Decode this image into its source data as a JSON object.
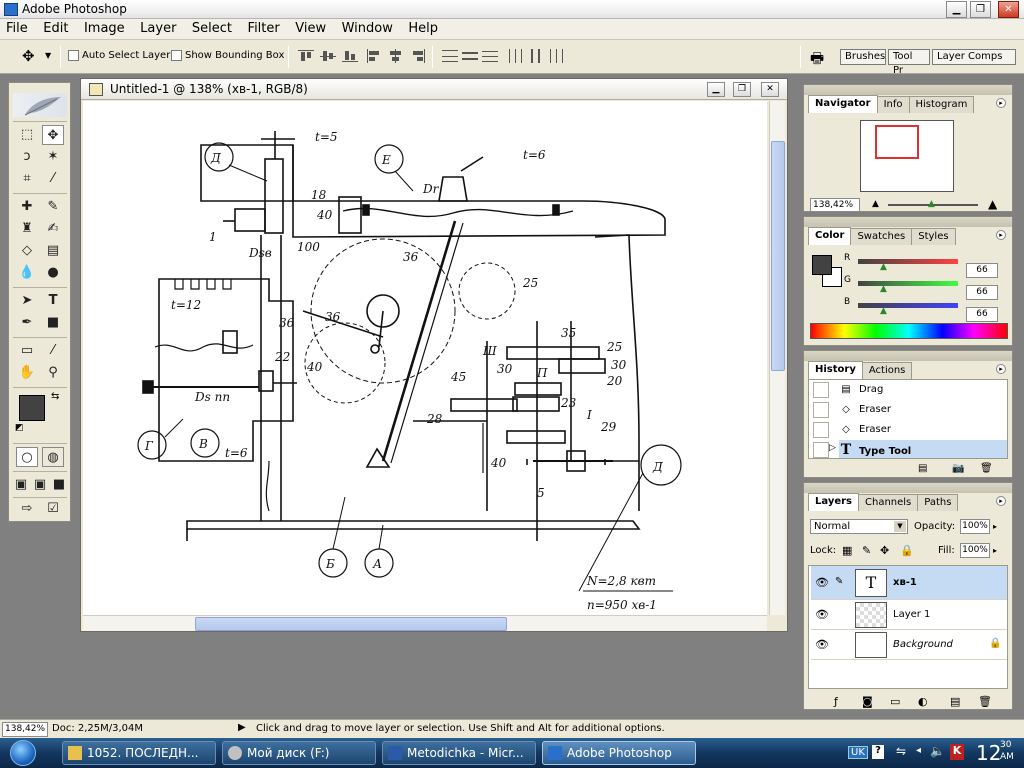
{
  "app": {
    "title": "Adobe Photoshop"
  },
  "menu": [
    "File",
    "Edit",
    "Image",
    "Layer",
    "Select",
    "Filter",
    "View",
    "Window",
    "Help"
  ],
  "options": {
    "auto_select": "Auto Select Layer",
    "bounding_box": "Show Bounding Box",
    "wells": [
      "Brushes",
      "Tool Pr",
      "Layer Comps"
    ]
  },
  "document": {
    "title": "Untitled-1 @ 138% (хв-1, RGB/8)",
    "drawing_labels": {
      "l_D": "Д",
      "l_t5": "t=5",
      "l_E": "Е",
      "l_t6": "t=6",
      "l_Dr": "Dr",
      "l_18": "18",
      "l_40a": "40",
      "l_1": "1",
      "l_Dsb": "Dsв",
      "l_100": "100",
      "l_36a": "36",
      "l_25a": "25",
      "l_t12": "t=12",
      "l_36b": "36",
      "l_36c": "36",
      "l_35": "35",
      "l_25b": "25",
      "l_30a": "30",
      "l_III": "Ш",
      "l_II": "П",
      "l_30b": "30",
      "l_20": "20",
      "l_22": "22",
      "l_40b": "40",
      "l_45": "45",
      "l_23": "23",
      "l_28": "28",
      "l_Dsnn": "Ds пп",
      "l_G": "Г",
      "l_V": "В",
      "l_t6b": "t=6",
      "l_I": "I",
      "l_29": "29",
      "l_Dd": "Д",
      "l_40c": "40",
      "l_5": "5",
      "l_B": "Б",
      "l_A": "А",
      "l_N": "N=2,8 квт",
      "l_n": "n=950 хв-1"
    }
  },
  "navigator": {
    "tabs": [
      "Navigator",
      "Info",
      "Histogram"
    ],
    "zoom": "138,42%"
  },
  "color": {
    "tabs": [
      "Color",
      "Swatches",
      "Styles"
    ],
    "channels": [
      {
        "label": "R",
        "value": "66",
        "level": 0.26
      },
      {
        "label": "G",
        "value": "66",
        "level": 0.26
      },
      {
        "label": "B",
        "value": "66",
        "level": 0.26
      }
    ]
  },
  "history": {
    "tabs": [
      "History",
      "Actions"
    ],
    "items": [
      {
        "label": "Drag",
        "icon": "drag"
      },
      {
        "label": "Eraser",
        "icon": "eraser"
      },
      {
        "label": "Eraser",
        "icon": "eraser"
      },
      {
        "label": "Type Tool",
        "icon": "type"
      }
    ]
  },
  "layers": {
    "tabs": [
      "Layers",
      "Channels",
      "Paths"
    ],
    "blend_mode": "Normal",
    "opacity_label": "Opacity:",
    "opacity": "100%",
    "lock_label": "Lock:",
    "fill_label": "Fill:",
    "fill": "100%",
    "items": [
      {
        "name": "хв-1"
      },
      {
        "name": "Layer 1"
      },
      {
        "name": "Background"
      }
    ]
  },
  "status": {
    "zoom": "138,42%",
    "doc": "Doc: 2,25M/3,04M",
    "hint": "Click and drag to move layer or selection.  Use Shift and Alt for additional options."
  },
  "taskbar": {
    "tasks": [
      "1052. ПОСЛЕДН...",
      "Мой диск (F:)",
      "Metodichka - Micr...",
      "Adobe Photoshop"
    ],
    "lang": "UK",
    "time": "12",
    "time_small": "30",
    "ampm": "AM"
  }
}
